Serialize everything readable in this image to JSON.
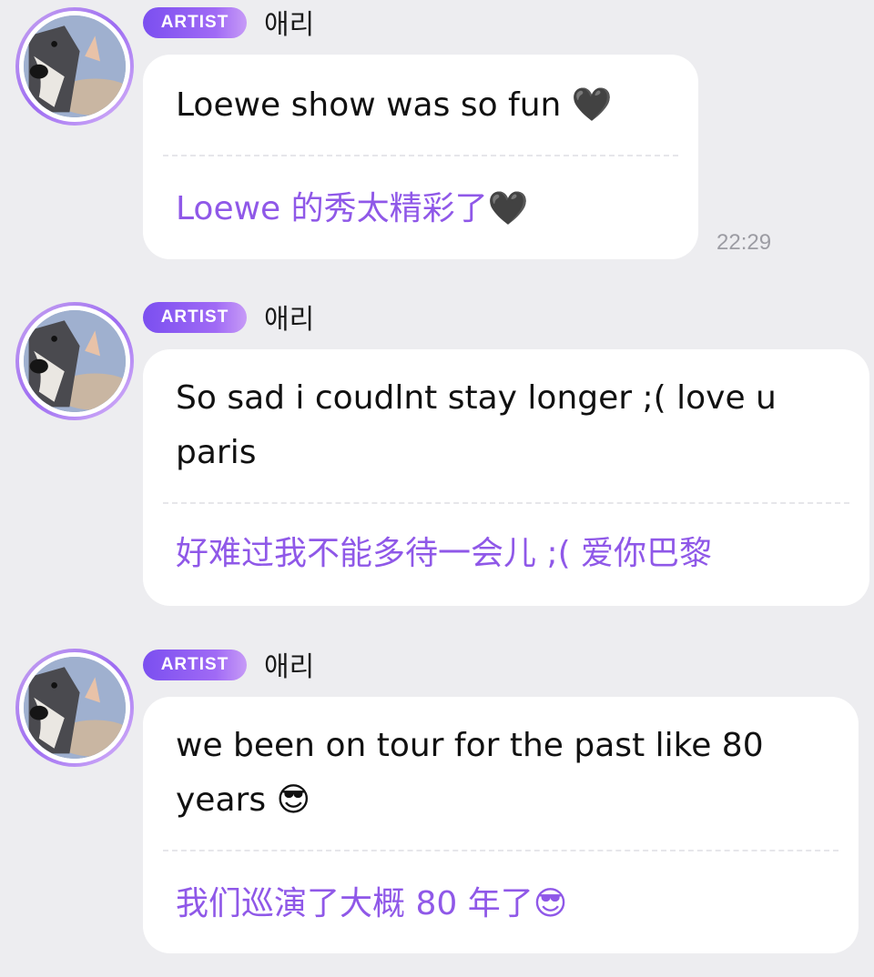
{
  "messages": [
    {
      "badge": "ARTIST",
      "username": "애리",
      "text": "Loewe show was so fun 🖤",
      "translation": "Loewe 的秀太精彩了🖤",
      "time": "22:29"
    },
    {
      "badge": "ARTIST",
      "username": "애리",
      "text": "So sad i coudlnt stay longer ;( love u paris",
      "translation": "好难过我不能多待一会儿 ;( 爱你巴黎"
    },
    {
      "badge": "ARTIST",
      "username": "애리",
      "text": "we been on tour for the past like 80 years 😎",
      "translation": "我们巡演了大概 80 年了😎"
    }
  ],
  "icons": {
    "avatar": "profile-photo-dog",
    "heart": "black-heart",
    "sunglasses": "sunglasses-face"
  },
  "colors": {
    "background": "#ededf0",
    "bubble": "#ffffff",
    "badge_gradient_start": "#7b4ff0",
    "translation_text": "#8f58e8",
    "timestamp": "#9c9ca3"
  }
}
